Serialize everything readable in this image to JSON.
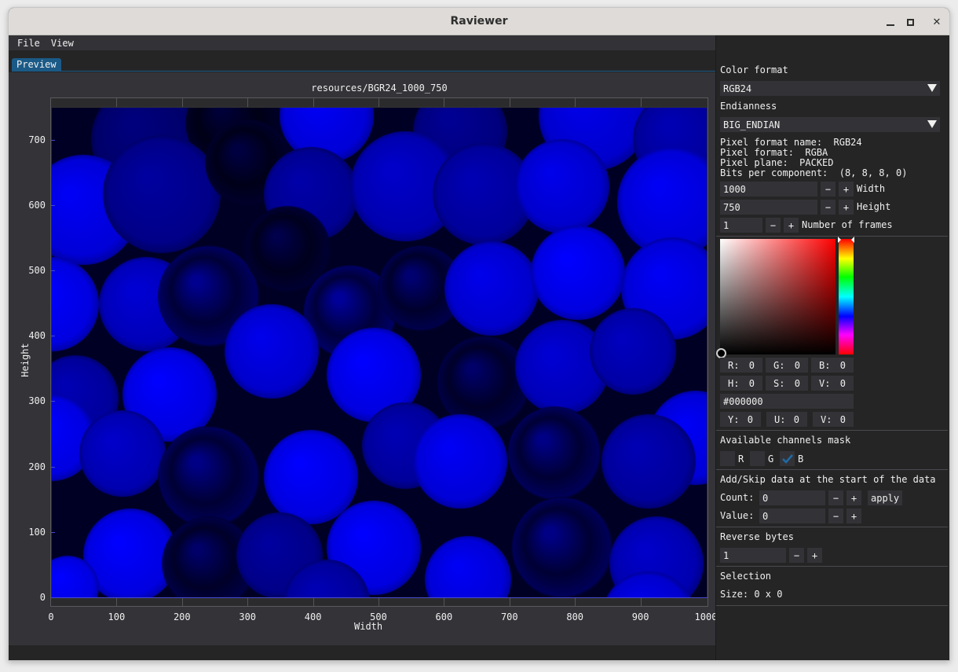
{
  "window": {
    "title": "Raviewer",
    "controls": {
      "minimize": "minimize",
      "maximize": "maximize",
      "close": "✕"
    }
  },
  "menubar": {
    "items": [
      {
        "label": "File"
      },
      {
        "label": "View"
      }
    ]
  },
  "tabs": [
    {
      "label": "Preview",
      "active": true
    }
  ],
  "preview": {
    "plot_title": "resources/BGR24_1000_750",
    "x_axis": {
      "title": "Width",
      "range": [
        0,
        1000
      ],
      "ticks": [
        "0",
        "100",
        "200",
        "300",
        "400",
        "500",
        "600",
        "700",
        "800",
        "900",
        "1000"
      ]
    },
    "y_axis": {
      "title": "Height",
      "range": [
        0,
        750
      ],
      "ticks": [
        "0",
        "100",
        "200",
        "300",
        "400",
        "500",
        "600",
        "700"
      ]
    },
    "image": {
      "description": "blue channel rendering of marbles",
      "dominant_color": "#0000ff"
    }
  },
  "sidebar": {
    "color_format": {
      "label": "Color format",
      "value": "RGB24"
    },
    "endianness": {
      "label": "Endianness",
      "value": "BIG_ENDIAN"
    },
    "info": {
      "pixel_format_name": "Pixel format name:  RGB24",
      "pixel_format": "Pixel format:  RGBA",
      "pixel_plane": "Pixel plane:  PACKED",
      "bits_per_component": "Bits per component:  (8, 8, 8, 0)"
    },
    "width": {
      "value": "1000",
      "label": "Width",
      "minus": "−",
      "plus": "+"
    },
    "height": {
      "value": "750",
      "label": "Height",
      "minus": "−",
      "plus": "+"
    },
    "frames": {
      "value": "1",
      "label": "Number of frames",
      "minus": "−",
      "plus": "+"
    },
    "color_picker": {
      "hue_color": "#ff0000",
      "selected_color": "#000000",
      "rgb": [
        {
          "label": "R:",
          "value": "0"
        },
        {
          "label": "G:",
          "value": "0"
        },
        {
          "label": "B:",
          "value": "0"
        }
      ],
      "hsv": [
        {
          "label": "H:",
          "value": "0"
        },
        {
          "label": "S:",
          "value": "0"
        },
        {
          "label": "V:",
          "value": "0"
        }
      ],
      "hex": "#000000",
      "yuv": [
        {
          "label": "Y:",
          "value": "0"
        },
        {
          "label": "U:",
          "value": "0"
        },
        {
          "label": "V:",
          "value": "0"
        }
      ]
    },
    "channels_mask": {
      "label": "Available channels mask",
      "channels": [
        {
          "label": "R",
          "checked": false
        },
        {
          "label": "G",
          "checked": false
        },
        {
          "label": "B",
          "checked": true
        }
      ],
      "check_color": "#1b5a86"
    },
    "add_skip": {
      "label": "Add/Skip data at the start of the data",
      "count_label": "Count:",
      "count_value": "0",
      "value_label": "Value:",
      "value_value": "0",
      "apply_label": "apply",
      "minus": "−",
      "plus": "+"
    },
    "reverse_bytes": {
      "label": "Reverse bytes",
      "value": "1",
      "minus": "−",
      "plus": "+"
    },
    "selection": {
      "label": "Selection",
      "size": "Size: 0 x 0"
    }
  }
}
